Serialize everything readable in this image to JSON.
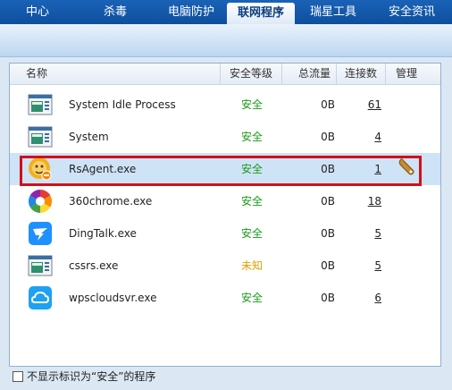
{
  "nav": {
    "items": [
      "中心",
      "杀毒",
      "电脑防护",
      "联网程序",
      "瑞星工具",
      "安全资讯"
    ],
    "active_index": 3
  },
  "table": {
    "headers": {
      "name": "名称",
      "safety": "安全等级",
      "traffic": "总流量",
      "connections": "连接数",
      "manage": "管理"
    },
    "rows": [
      {
        "icon": "system-window-icon",
        "name": "System Idle Process",
        "safety": "安全",
        "traffic": "0B",
        "connections": "61"
      },
      {
        "icon": "system-window-icon",
        "name": "System",
        "safety": "安全",
        "traffic": "0B",
        "connections": "4"
      },
      {
        "icon": "rising-lion-icon",
        "name": "RsAgent.exe",
        "safety": "安全",
        "traffic": "0B",
        "connections": "1",
        "selected": true,
        "manage_icon": "wrench-icon"
      },
      {
        "icon": "360chrome-icon",
        "name": "360chrome.exe",
        "safety": "安全",
        "traffic": "0B",
        "connections": "18"
      },
      {
        "icon": "dingtalk-icon",
        "name": "DingTalk.exe",
        "safety": "安全",
        "traffic": "0B",
        "connections": "5"
      },
      {
        "icon": "system-window-icon",
        "name": "cssrs.exe",
        "safety": "未知",
        "traffic": "0B",
        "connections": "5"
      },
      {
        "icon": "wps-cloud-icon",
        "name": "wpscloudsvr.exe",
        "safety": "安全",
        "traffic": "0B",
        "connections": "6"
      }
    ]
  },
  "colors": {
    "safe": "#1a9a1a",
    "unknown": "#e0a000",
    "highlight": "#d0101a"
  },
  "footer": {
    "checkbox_label": "不显示标识为“安全”的程序",
    "checked": false
  }
}
